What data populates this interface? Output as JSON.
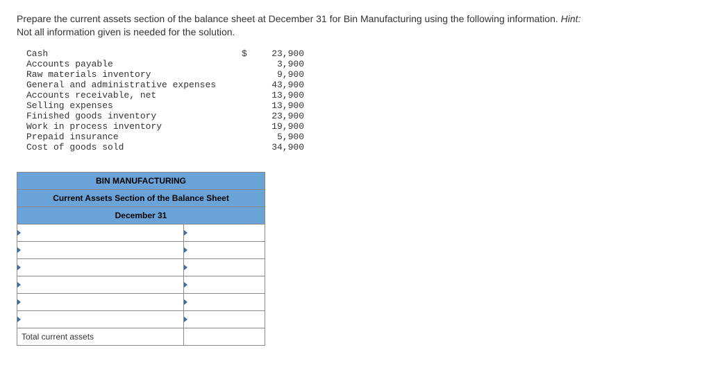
{
  "prompt": {
    "main": "Prepare the current assets section of the balance sheet at December 31 for Bin Manufacturing using the following information. ",
    "hint_label": "Hint:",
    "line2": "Not all information given is needed for the solution."
  },
  "given": {
    "items": [
      {
        "label": "Cash",
        "value": "23,900",
        "dollar": "$"
      },
      {
        "label": "Accounts payable",
        "value": "3,900",
        "dollar": ""
      },
      {
        "label": "Raw materials inventory",
        "value": "9,900",
        "dollar": ""
      },
      {
        "label": "General and administrative expenses",
        "value": "43,900",
        "dollar": ""
      },
      {
        "label": "Accounts receivable, net",
        "value": "13,900",
        "dollar": ""
      },
      {
        "label": "Selling expenses",
        "value": "13,900",
        "dollar": ""
      },
      {
        "label": "Finished goods inventory",
        "value": "23,900",
        "dollar": ""
      },
      {
        "label": "Work in process inventory",
        "value": "19,900",
        "dollar": ""
      },
      {
        "label": "Prepaid insurance",
        "value": "5,900",
        "dollar": ""
      },
      {
        "label": "Cost of goods sold",
        "value": "34,900",
        "dollar": ""
      }
    ]
  },
  "sheet": {
    "company": "BIN MANUFACTURING",
    "title": "Current Assets Section of the Balance Sheet",
    "date": "December 31",
    "total_label": "Total current assets"
  }
}
